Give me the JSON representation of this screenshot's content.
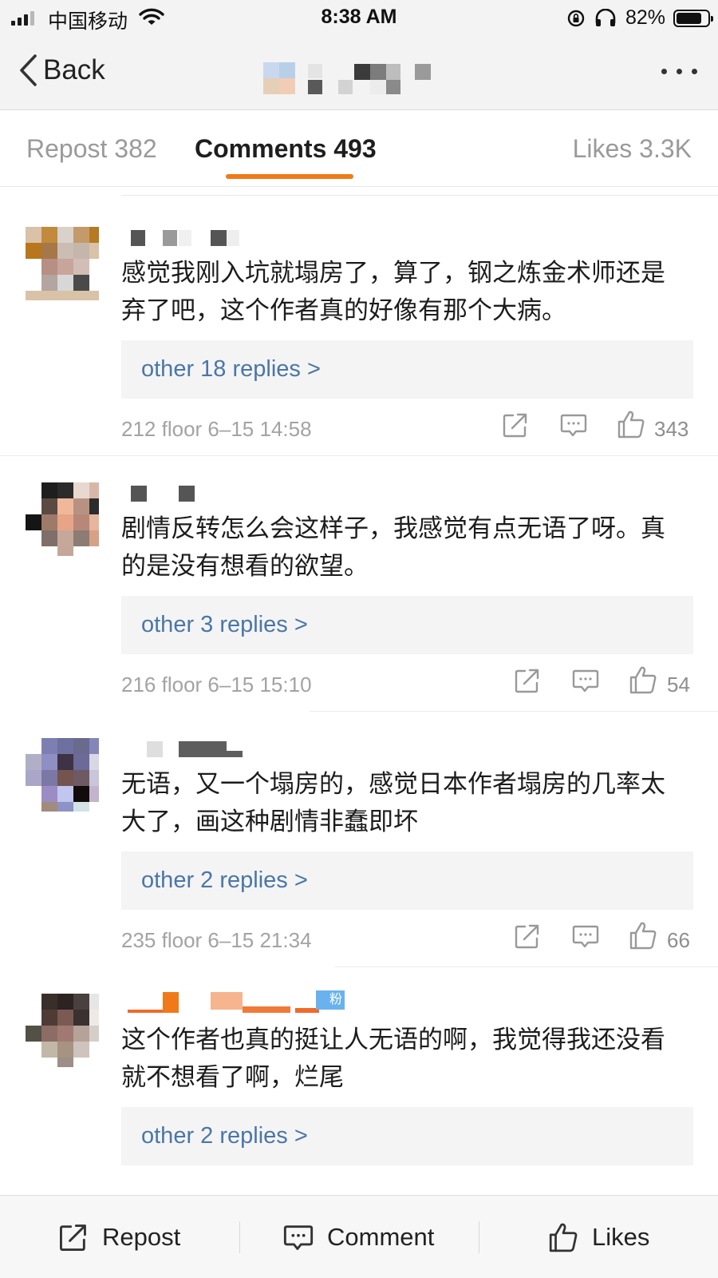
{
  "status_bar": {
    "carrier": "中国移动",
    "time": "8:38 AM",
    "battery_percent": "82%",
    "battery_level": 0.82,
    "icons": [
      "signal-icon",
      "wifi-icon",
      "orientation-lock-icon",
      "headphones-icon",
      "battery-icon"
    ]
  },
  "nav": {
    "back_label": "Back",
    "more_icon": "ellipsis-icon"
  },
  "tabs": [
    {
      "label": "Repost 382"
    },
    {
      "label": "Comments 493"
    },
    {
      "label": "Likes 3.3K"
    }
  ],
  "colors": {
    "accent": "#f07a17",
    "link": "#4a76a8",
    "meta": "#a3a3a3"
  },
  "comments": [
    {
      "text": "感觉我刚入坑就塌房了，算了，钢之炼金术师还是弃了吧，这个作者真的好像有那个大病。",
      "replies_label": "other 18 replies >",
      "meta": "212 floor 6–15 14:58",
      "likes": "343"
    },
    {
      "text": "剧情反转怎么会这样子，我感觉有点无语了呀。真的是没有想看的欲望。",
      "replies_label": "other 3 replies >",
      "meta": "216 floor 6–15 15:10",
      "likes": "54"
    },
    {
      "text": "无语，又一个塌房的，感觉日本作者塌房的几率太大了，画这种剧情非蠢即坏",
      "replies_label": "other 2 replies >",
      "meta": "235 floor 6–15 21:34",
      "likes": "66"
    },
    {
      "text": "这个作者也真的挺让人无语的啊，我觉得我还没看就不想看了啊，烂尾",
      "replies_label": "other 2 replies >",
      "badge": "粉"
    }
  ],
  "bottom_bar": {
    "repost_label": "Repost",
    "comment_label": "Comment",
    "likes_label": "Likes"
  }
}
